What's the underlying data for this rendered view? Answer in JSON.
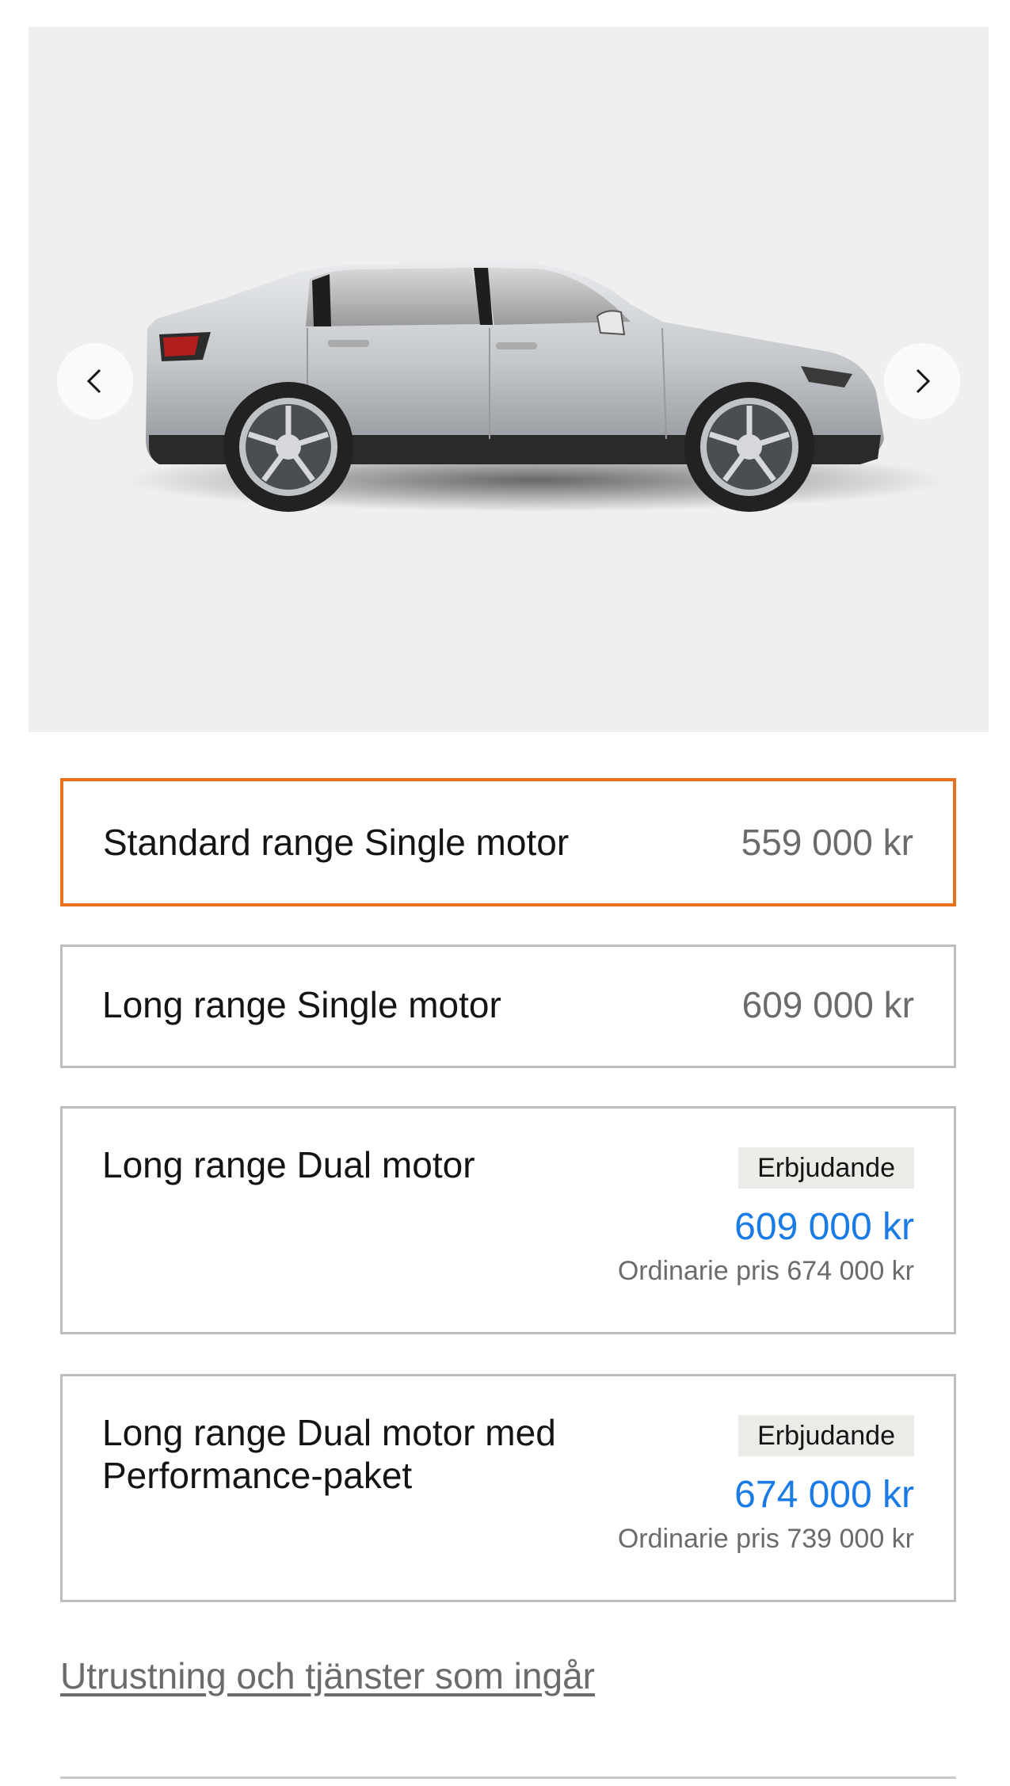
{
  "gallery": {
    "prev_label": "Previous image",
    "next_label": "Next image",
    "image_alt": "Silver electric fastback sedan, side view"
  },
  "options": [
    {
      "name": "Standard range Single motor",
      "price": "559 000 kr",
      "selected": true
    },
    {
      "name": "Long range Single motor",
      "price": "609 000 kr",
      "selected": false
    },
    {
      "name": "Long range Dual motor",
      "badge": "Erbjudande",
      "offer_price": "609 000 kr",
      "regular_price": "Ordinarie pris 674 000 kr",
      "selected": false
    },
    {
      "name_line1": "Long range Dual motor med",
      "name_line2": "Performance-paket",
      "badge": "Erbjudande",
      "offer_price": "674 000 kr",
      "regular_price": "Ordinarie pris 739 000 kr",
      "selected": false
    }
  ],
  "equipment_link": "Utrustning och tjänster som ingår",
  "colors": {
    "selected_border": "#e8701a",
    "offer_price": "#1a7ae6",
    "badge_bg": "#ebebe8"
  }
}
